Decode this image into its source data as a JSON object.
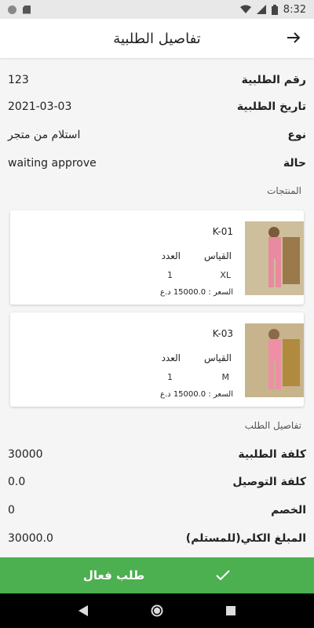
{
  "status_bar": {
    "time": "8:32"
  },
  "header": {
    "title": "تفاصيل الطلبية",
    "back_icon": "arrow-right-icon"
  },
  "order_info": [
    {
      "label": "رقم الطلبية",
      "value": "123"
    },
    {
      "label": "تاريخ الطلبية",
      "value": "2021-03-03"
    },
    {
      "label": "نوع",
      "value": "استلام من متجر"
    },
    {
      "label": "حالة",
      "value": "waiting approve"
    }
  ],
  "products_section": {
    "title": "المنتجات",
    "items": [
      {
        "code": "K-01",
        "size_label": "القياس",
        "qty_label": "العدد",
        "size": "XL",
        "qty": "1",
        "price_label": "السعر :",
        "price": "15000.0",
        "currency": "د.ع"
      },
      {
        "code": "K-03",
        "size_label": "القياس",
        "qty_label": "العدد",
        "size": "M",
        "qty": "1",
        "price_label": "السعر :",
        "price": "15000.0",
        "currency": "د.ع"
      }
    ]
  },
  "order_details_section": {
    "title": "تفاصيل الطلب",
    "rows": [
      {
        "label": "كلفة الطلبية",
        "value": "30000"
      },
      {
        "label": "كلفة التوصيل",
        "value": "0.0"
      },
      {
        "label": "الخصم",
        "value": "0"
      },
      {
        "label": "المبلغ الكلي(للمستلم)",
        "value": "30000.0"
      }
    ]
  },
  "action_button": {
    "label": "طلب فعال",
    "icon": "check-icon",
    "color": "#4caf50"
  }
}
